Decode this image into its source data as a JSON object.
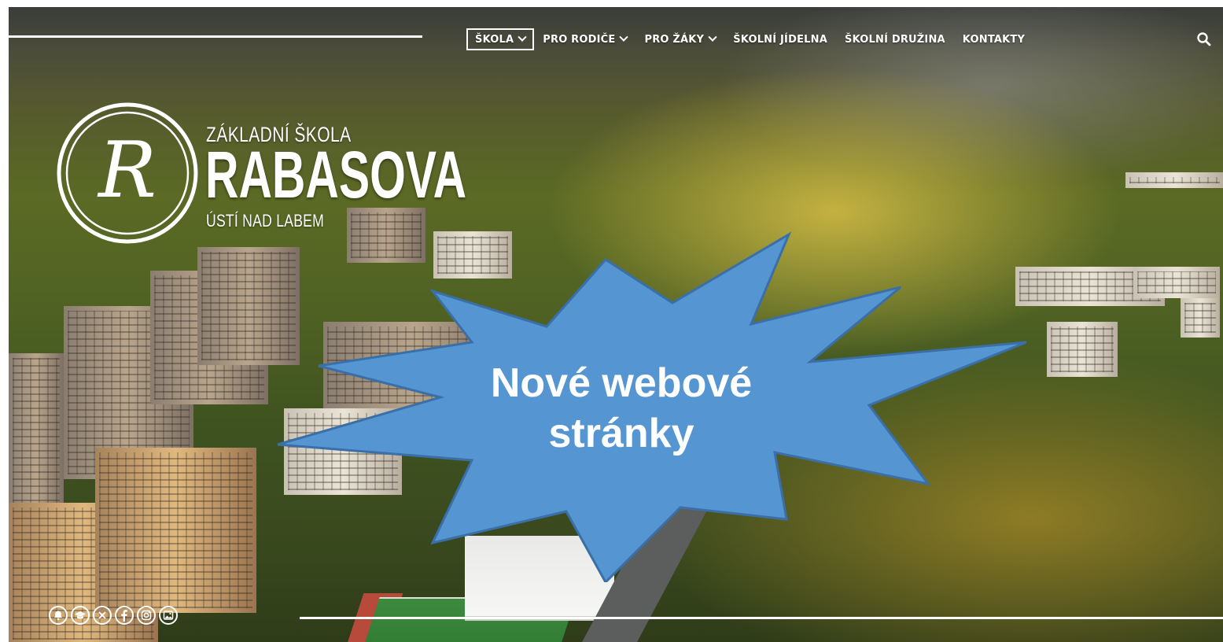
{
  "nav": {
    "items": [
      {
        "label": "ŠKOLA",
        "has_dropdown": true,
        "active": true
      },
      {
        "label": "PRO RODIČE",
        "has_dropdown": true,
        "active": false
      },
      {
        "label": "PRO ŽÁKY",
        "has_dropdown": true,
        "active": false
      },
      {
        "label": "ŠKOLNÍ JÍDELNA",
        "has_dropdown": false,
        "active": false
      },
      {
        "label": "ŠKOLNÍ DRUŽINA",
        "has_dropdown": false,
        "active": false
      },
      {
        "label": "KONTAKTY",
        "has_dropdown": false,
        "active": false
      }
    ],
    "search_icon": "search-icon"
  },
  "logo": {
    "monogram": "R",
    "line1": "ZÁKLADNÍ ŠKOLA",
    "line2": "RABASOVA",
    "line3": "ÚSTÍ NAD LABEM"
  },
  "announcement": {
    "line1": "Nové webové",
    "line2": "stránky",
    "fill_color": "#5596d2",
    "stroke_color": "#3a6fa8"
  },
  "social_icons": [
    "bell-icon",
    "graduation-cap-icon",
    "cutlery-icon",
    "facebook-icon",
    "instagram-icon",
    "gallery-icon"
  ],
  "colors": {
    "nav_text": "#ffffff",
    "logo_text": "#ffffff"
  }
}
